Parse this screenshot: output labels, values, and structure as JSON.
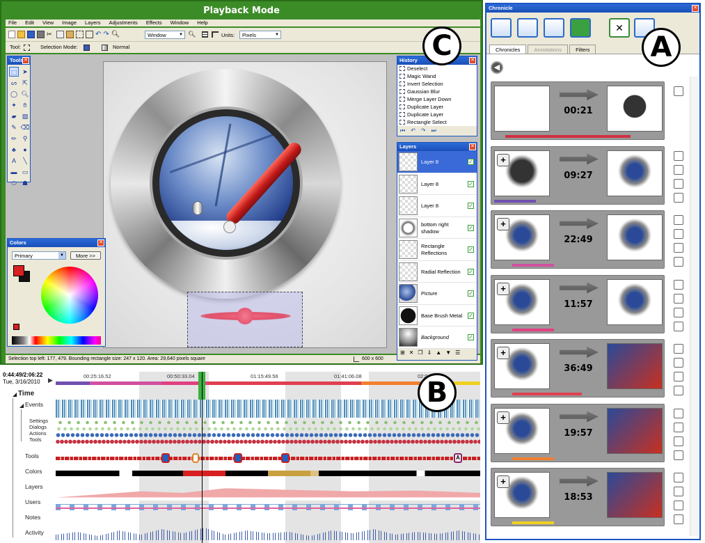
{
  "window_title": "Playback Mode",
  "menu": [
    "File",
    "Edit",
    "View",
    "Image",
    "Layers",
    "Adjustments",
    "Effects",
    "Window",
    "Help"
  ],
  "toolbar": {
    "zoom_value": "Window",
    "units_label": "Units:",
    "units_value": "Pixels",
    "tool_label": "Tool:",
    "selection_mode_label": "Selection Mode:",
    "blend_value": "Normal"
  },
  "tools_panel": {
    "title": "Tools"
  },
  "history_panel": {
    "title": "History",
    "items": [
      "Deselect",
      "Magic Wand",
      "Invert Selection",
      "Gaussian Blur",
      "Merge Layer Down",
      "Duplicate Layer",
      "Duplicate Layer",
      "Rectangle Select"
    ]
  },
  "layers_panel": {
    "title": "Layers",
    "items": [
      "Layer 8",
      "Layer 8",
      "Layer 8",
      "bottom right shadow",
      "Rectangle Reflections",
      "Radial Reflection",
      "Picture",
      "Base Brush Metal",
      "Background"
    ]
  },
  "colors_panel": {
    "title": "Colors",
    "mode": "Primary",
    "more_button": "More >>",
    "primary_color": "#d82020",
    "secondary_color": "#111111"
  },
  "status": {
    "selection_text": "Selection top left: 177, 479. Bounding rectangle size: 247 x 120. Area: 29,640 pixels square",
    "image_size": "600 x 600"
  },
  "timeline": {
    "current_time": "0:44:49/2:06:22",
    "date": "Tue, 3/16/2010",
    "ticks": [
      "00:25:16.52",
      "00:50:33.04",
      "01:15:49.56",
      "01:41:06.08",
      "02:0"
    ],
    "rows": {
      "time": "Time",
      "events": "Events",
      "settings": "Settings",
      "dialogs": "Dialogs",
      "actions": "Actions",
      "tools_sub": "Tools",
      "tools": "Tools",
      "colors": "Colors",
      "layers": "Layers",
      "users": "Users",
      "notes": "Notes",
      "activity": "Activity"
    }
  },
  "chronicle": {
    "title": "Chronicle",
    "tabs": [
      "Chronicles",
      "Annotations",
      "Filters"
    ],
    "frames": [
      {
        "duration": "00:21",
        "bar_color": "#d03040"
      },
      {
        "duration": "09:27",
        "bar_color": "#7050b0"
      },
      {
        "duration": "22:49",
        "bar_color": "#d050a0"
      },
      {
        "duration": "11:57",
        "bar_color": "#e04080"
      },
      {
        "duration": "36:49",
        "bar_color": "#e04050"
      },
      {
        "duration": "19:57",
        "bar_color": "#f08030"
      },
      {
        "duration": "18:53",
        "bar_color": "#f0d020"
      }
    ]
  },
  "callouts": {
    "a": "A",
    "b": "B",
    "c": "C"
  },
  "colors": {
    "accent_green": "#2f8a1e",
    "xp_blue": "#1b56c0",
    "canvas_bg": "#c0c0c0"
  }
}
